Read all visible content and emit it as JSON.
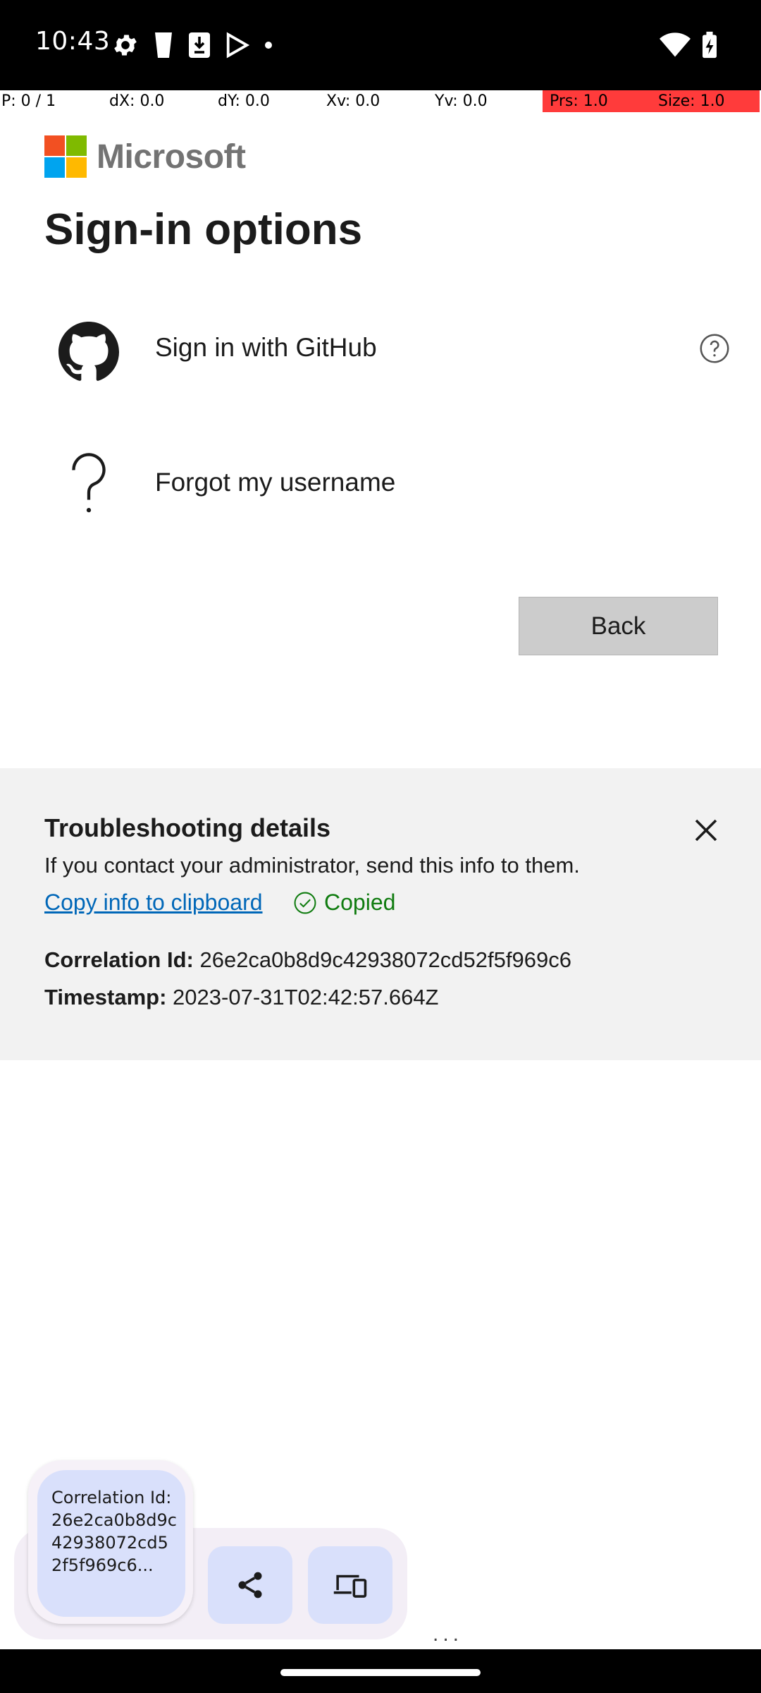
{
  "status_bar": {
    "time": "10:43",
    "left_icons": [
      "settings-gear-icon",
      "cup-icon",
      "download-box-icon",
      "play-store-icon",
      "dot-icon"
    ],
    "right_icons": [
      "wifi-icon",
      "battery-charging-icon"
    ]
  },
  "pointer_location": {
    "p": "P: 0 / 1",
    "dx": "dX: 0.0",
    "dy": "dY: 0.0",
    "xv": "Xv: 0.0",
    "yv": "Yv: 0.0",
    "prs": "Prs: 1.0",
    "size": "Size: 1.0",
    "highlight_color": "#ff3b3b"
  },
  "header": {
    "brand": "Microsoft",
    "logo_colors": [
      "#f25022",
      "#7fba00",
      "#00a4ef",
      "#ffb900"
    ]
  },
  "main": {
    "title": "Sign-in options",
    "options": [
      {
        "label": "Sign in with GitHub",
        "icon": "github-icon",
        "has_help": true
      },
      {
        "label": "Forgot my username",
        "icon": "question-mark-icon",
        "has_help": false
      }
    ],
    "back_label": "Back"
  },
  "troubleshooting": {
    "title": "Troubleshooting details",
    "description": "If you contact your administrator, send this info to them.",
    "copy_link": "Copy info to clipboard",
    "copied_label": "Copied",
    "correlation_label": "Correlation Id:",
    "correlation_value": "26e2ca0b8d9c42938072cd52f5f969c6",
    "timestamp_label": "Timestamp:",
    "timestamp_value": "2023-07-31T02:42:57.664Z"
  },
  "clipboard_overlay": {
    "preview_text": "Correlation Id: 26e2ca0b8d9c42938072cd52f5f969c6...",
    "buttons": [
      "share-icon",
      "nearby-devices-icon"
    ],
    "more": "..."
  },
  "colors": {
    "accent_link": "#0067b8",
    "success": "#107c10",
    "panel_bg": "#f2f2f2",
    "button_bg": "#cccccc",
    "chip_bg": "#d9e0fb"
  }
}
